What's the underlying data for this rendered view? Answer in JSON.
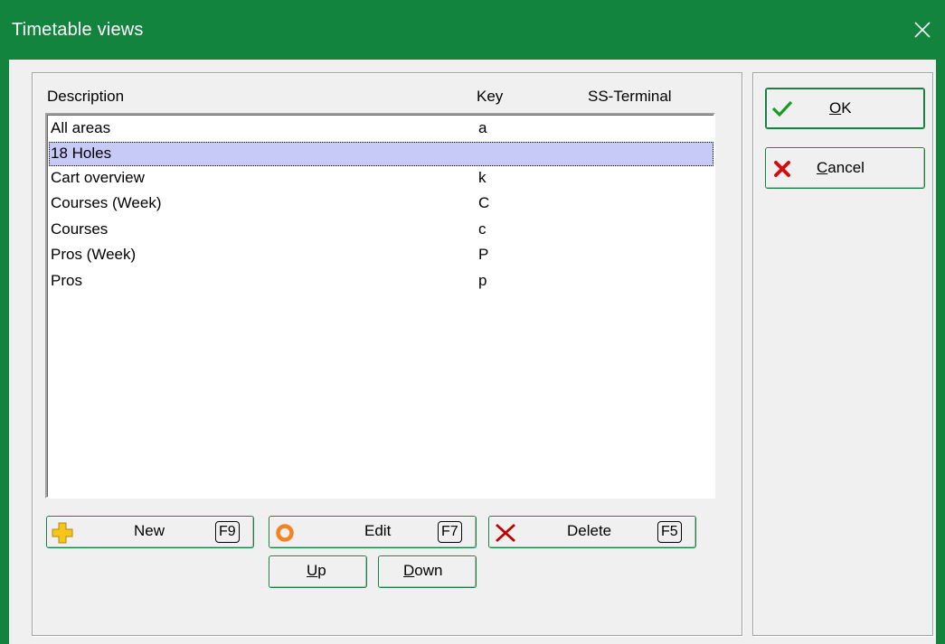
{
  "window": {
    "title": "Timetable views"
  },
  "list": {
    "columns": {
      "description": "Description",
      "key": "Key",
      "ss_terminal": "SS-Terminal"
    },
    "rows": [
      {
        "description": "All areas",
        "key": "a",
        "ss_terminal": ""
      },
      {
        "description": "18 Holes",
        "key": "",
        "ss_terminal": ""
      },
      {
        "description": "Cart overview",
        "key": "k",
        "ss_terminal": ""
      },
      {
        "description": "Courses (Week)",
        "key": "C",
        "ss_terminal": ""
      },
      {
        "description": "Courses",
        "key": "c",
        "ss_terminal": ""
      },
      {
        "description": "Pros (Week)",
        "key": "P",
        "ss_terminal": ""
      },
      {
        "description": "Pros",
        "key": "p",
        "ss_terminal": ""
      }
    ],
    "selected_index": 1
  },
  "buttons": {
    "new": {
      "label": "New",
      "shortcut": "F9",
      "icon": "plus-icon"
    },
    "edit": {
      "label": "Edit",
      "shortcut": "F7",
      "icon": "circle-icon"
    },
    "delete": {
      "label": "Delete",
      "shortcut": "F5",
      "icon": "x-icon"
    },
    "up": {
      "label_first": "U",
      "label_rest": "p"
    },
    "down": {
      "label_first": "D",
      "label_rest": "own"
    },
    "ok": {
      "label_first": "O",
      "label_rest": "K",
      "icon": "check-icon"
    },
    "cancel": {
      "label_first": "C",
      "label_rest": "ancel",
      "icon": "cancel-x-icon"
    }
  },
  "colors": {
    "titlebar": "#13843d",
    "selection": "#c7c9f7",
    "plus": "#f5c518",
    "edit": "#f58220",
    "delete": "#c00000",
    "ok": "#1a9a2a",
    "cancel": "#d01010"
  }
}
